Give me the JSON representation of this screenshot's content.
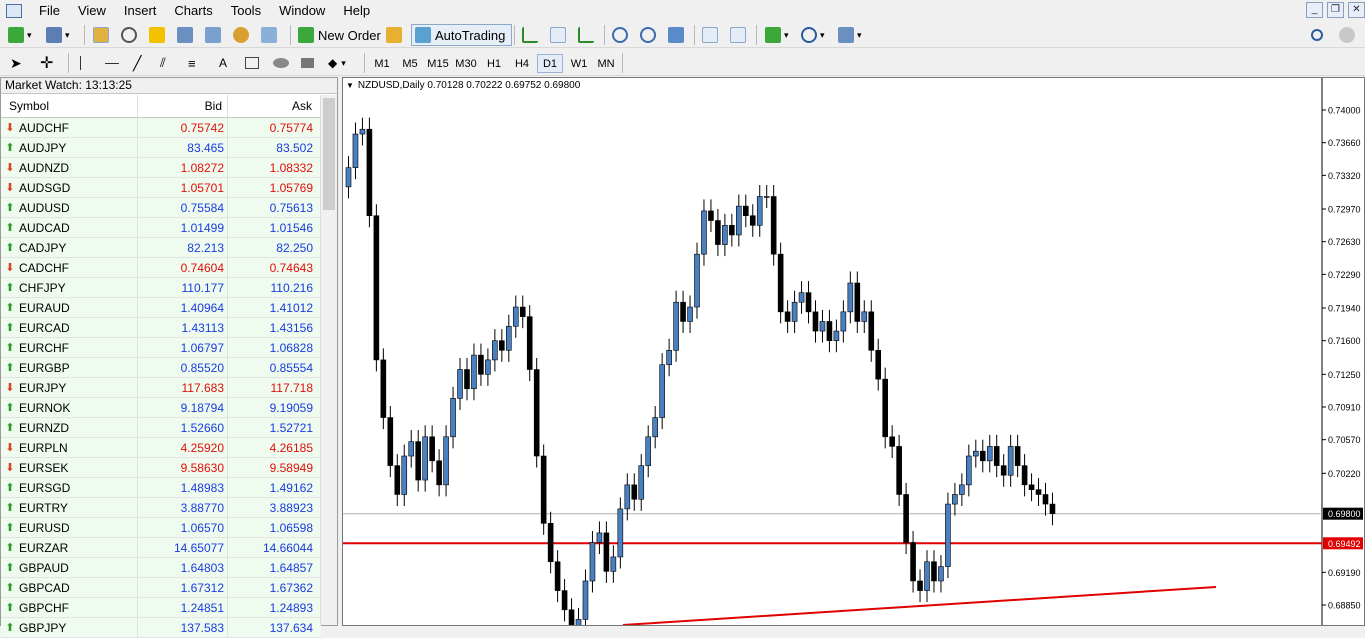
{
  "menu": [
    "File",
    "View",
    "Insert",
    "Charts",
    "Tools",
    "Window",
    "Help"
  ],
  "toolbar": {
    "new_order": "New Order",
    "autotrading": "AutoTrading"
  },
  "timeframes": [
    "M1",
    "M5",
    "M15",
    "M30",
    "H1",
    "H4",
    "D1",
    "W1",
    "MN"
  ],
  "active_timeframe": "D1",
  "market_watch": {
    "title": "Market Watch: 13:13:25",
    "columns": {
      "symbol": "Symbol",
      "bid": "Bid",
      "ask": "Ask"
    },
    "rows": [
      {
        "symbol": "AUDCHF",
        "bid": "0.75742",
        "ask": "0.75774",
        "dir": "down"
      },
      {
        "symbol": "AUDJPY",
        "bid": "83.465",
        "ask": "83.502",
        "dir": "up"
      },
      {
        "symbol": "AUDNZD",
        "bid": "1.08272",
        "ask": "1.08332",
        "dir": "down"
      },
      {
        "symbol": "AUDSGD",
        "bid": "1.05701",
        "ask": "1.05769",
        "dir": "down"
      },
      {
        "symbol": "AUDUSD",
        "bid": "0.75584",
        "ask": "0.75613",
        "dir": "up"
      },
      {
        "symbol": "AUDCAD",
        "bid": "1.01499",
        "ask": "1.01546",
        "dir": "up"
      },
      {
        "symbol": "CADJPY",
        "bid": "82.213",
        "ask": "82.250",
        "dir": "up"
      },
      {
        "symbol": "CADCHF",
        "bid": "0.74604",
        "ask": "0.74643",
        "dir": "down"
      },
      {
        "symbol": "CHFJPY",
        "bid": "110.177",
        "ask": "110.216",
        "dir": "up"
      },
      {
        "symbol": "EURAUD",
        "bid": "1.40964",
        "ask": "1.41012",
        "dir": "up"
      },
      {
        "symbol": "EURCAD",
        "bid": "1.43113",
        "ask": "1.43156",
        "dir": "up"
      },
      {
        "symbol": "EURCHF",
        "bid": "1.06797",
        "ask": "1.06828",
        "dir": "up"
      },
      {
        "symbol": "EURGBP",
        "bid": "0.85520",
        "ask": "0.85554",
        "dir": "up"
      },
      {
        "symbol": "EURJPY",
        "bid": "117.683",
        "ask": "117.718",
        "dir": "down"
      },
      {
        "symbol": "EURNOK",
        "bid": "9.18794",
        "ask": "9.19059",
        "dir": "up"
      },
      {
        "symbol": "EURNZD",
        "bid": "1.52660",
        "ask": "1.52721",
        "dir": "up"
      },
      {
        "symbol": "EURPLN",
        "bid": "4.25920",
        "ask": "4.26185",
        "dir": "down"
      },
      {
        "symbol": "EURSEK",
        "bid": "9.58630",
        "ask": "9.58949",
        "dir": "down"
      },
      {
        "symbol": "EURSGD",
        "bid": "1.48983",
        "ask": "1.49162",
        "dir": "up"
      },
      {
        "symbol": "EURTRY",
        "bid": "3.88770",
        "ask": "3.88923",
        "dir": "up"
      },
      {
        "symbol": "EURUSD",
        "bid": "1.06570",
        "ask": "1.06598",
        "dir": "up"
      },
      {
        "symbol": "EURZAR",
        "bid": "14.65077",
        "ask": "14.66044",
        "dir": "up"
      },
      {
        "symbol": "GBPAUD",
        "bid": "1.64803",
        "ask": "1.64857",
        "dir": "up"
      },
      {
        "symbol": "GBPCAD",
        "bid": "1.67312",
        "ask": "1.67362",
        "dir": "up"
      },
      {
        "symbol": "GBPCHF",
        "bid": "1.24851",
        "ask": "1.24893",
        "dir": "up"
      },
      {
        "symbol": "GBPJPY",
        "bid": "137.583",
        "ask": "137.634",
        "dir": "up"
      }
    ]
  },
  "chart": {
    "title": "NZDUSD,Daily  0.70128 0.70222 0.69752 0.69800",
    "price_labels": [
      "0.74000",
      "0.73660",
      "0.73320",
      "0.72970",
      "0.72630",
      "0.72290",
      "0.71940",
      "0.71600",
      "0.71250",
      "0.70910",
      "0.70570",
      "0.70220",
      "0.69800",
      "0.69492",
      "0.69190",
      "0.68850"
    ],
    "bid_line": "0.69800",
    "level_line": "0.69492",
    "colors": {
      "up": "#4a7fc1",
      "down": "#000000",
      "level": "#e00000",
      "bid": "#000000",
      "buy": "#2a9d2a",
      "sell": "#d9441c"
    }
  }
}
